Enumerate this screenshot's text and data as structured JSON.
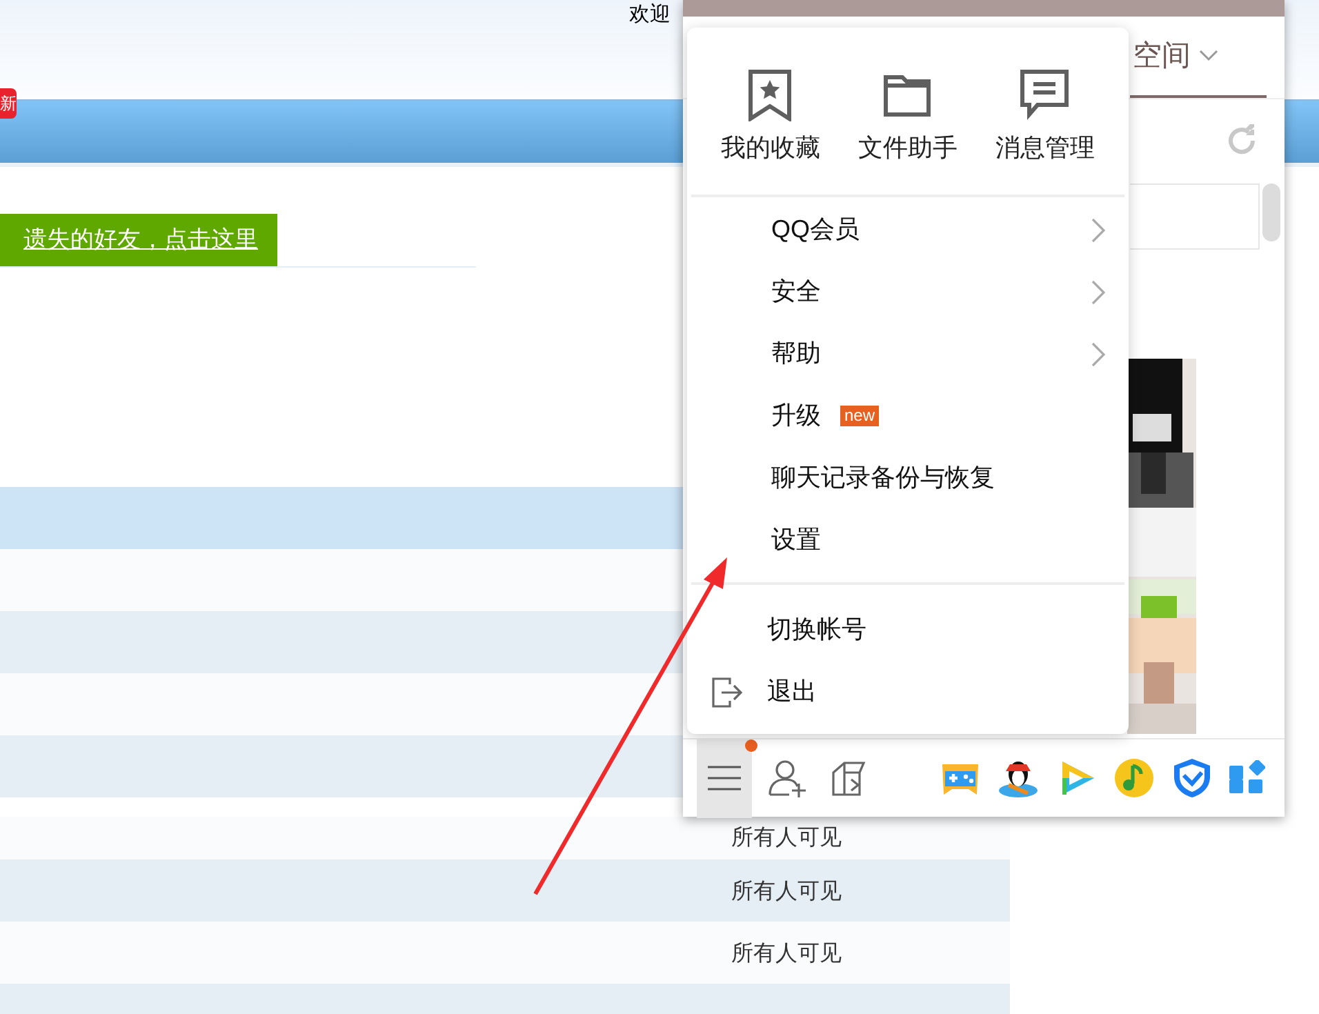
{
  "page": {
    "greeting": "欢迎",
    "badge": "新",
    "banner_link": "遗失的好友，点击这里",
    "rows": [
      {
        "selected": true
      },
      {
        "selected": false
      },
      {
        "selected": false
      },
      {
        "selected": false
      },
      {
        "selected": false
      },
      {
        "selected": false,
        "visibility": "所有人可见"
      },
      {
        "selected": false,
        "visibility": "所有人可见"
      },
      {
        "selected": false,
        "visibility": "所有人可见"
      },
      {
        "selected": false
      }
    ]
  },
  "qq_window": {
    "tabs": [
      {
        "label": "空间",
        "selected": true
      }
    ],
    "toolbar": {
      "menu_open": true,
      "notification_dot": true
    }
  },
  "menu": {
    "shortcuts": [
      {
        "kind": "bookmark",
        "label": "我的收藏"
      },
      {
        "kind": "folder",
        "label": "文件助手"
      },
      {
        "kind": "message",
        "label": "消息管理"
      }
    ],
    "items": [
      {
        "kind": "submenu",
        "label": "QQ会员"
      },
      {
        "kind": "submenu",
        "label": "安全"
      },
      {
        "kind": "submenu",
        "label": "帮助"
      },
      {
        "kind": "badge",
        "label": "升级",
        "badge": "new"
      },
      {
        "kind": "plain",
        "label": "聊天记录备份与恢复"
      },
      {
        "kind": "plain",
        "label": "设置"
      }
    ],
    "footer_items": [
      {
        "kind": "plain",
        "label": "切换帐号"
      },
      {
        "kind": "exit",
        "label": "退出"
      }
    ]
  },
  "annotation": {
    "kind": "arrow"
  }
}
